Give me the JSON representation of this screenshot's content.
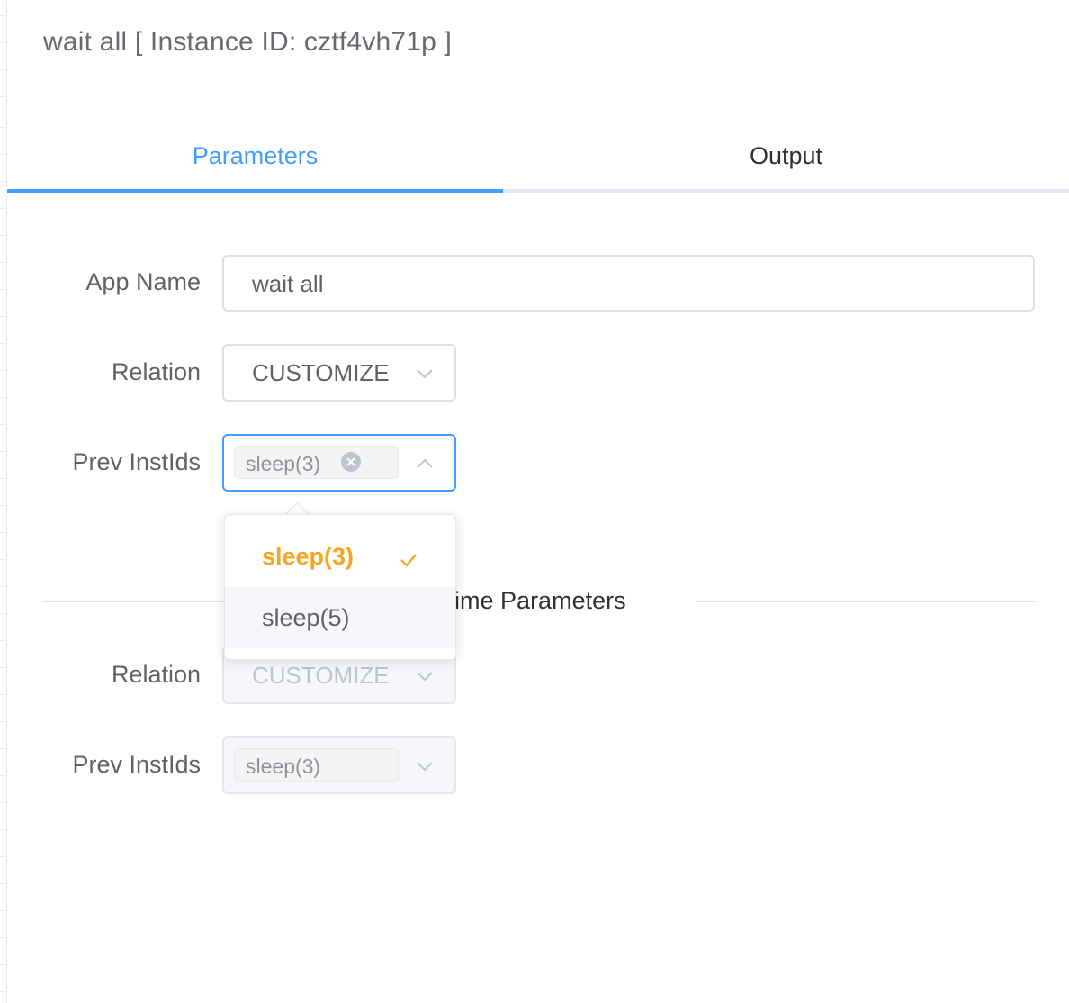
{
  "header": {
    "title": "wait all [ Instance ID: cztf4vh71p ]"
  },
  "tabs": [
    {
      "label": "Parameters",
      "active": true
    },
    {
      "label": "Output",
      "active": false
    }
  ],
  "form": {
    "app_name": {
      "label": "App Name",
      "value": "wait all"
    },
    "relation": {
      "label": "Relation",
      "value": "CUSTOMIZE"
    },
    "prev_inst_ids": {
      "label": "Prev InstIds",
      "tag": "sleep(3)"
    }
  },
  "divider": {
    "text": "Runtime Parameters"
  },
  "runtime": {
    "relation": {
      "label": "Relation",
      "value": "CUSTOMIZE"
    },
    "prev_inst_ids": {
      "label": "Prev InstIds",
      "tag": "sleep(3)"
    }
  },
  "dropdown": {
    "options": [
      {
        "label": "sleep(3)",
        "selected": true
      },
      {
        "label": "sleep(5)",
        "selected": false
      }
    ]
  },
  "colors": {
    "accent": "#409eff",
    "selected_option": "#f5a623"
  }
}
